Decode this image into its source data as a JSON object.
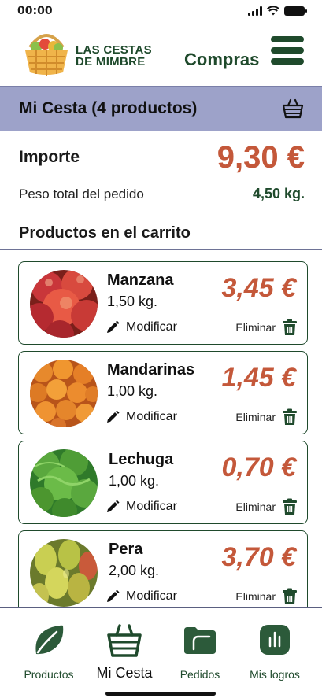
{
  "status_bar": {
    "time": "00:00"
  },
  "header": {
    "logo_line1": "LAS CESTAS",
    "logo_line2": "DE MIMBRE",
    "title": "Compras",
    "menu_icon": "hamburger-icon"
  },
  "section": {
    "title": "Mi Cesta (4 productos)",
    "icon": "basket-icon"
  },
  "summary": {
    "importe_label": "Importe",
    "importe_value": "9,30 €",
    "peso_label": "Peso total del pedido",
    "peso_value": "4,50 kg."
  },
  "cart_heading": "Productos en el carrito",
  "products": [
    {
      "name": "Manzana",
      "weight": "1,50 kg.",
      "price": "3,45 €",
      "modify": "Modificar",
      "remove": "Eliminar",
      "image": "apples"
    },
    {
      "name": "Mandarinas",
      "weight": "1,00 kg.",
      "price": "1,45 €",
      "modify": "Modificar",
      "remove": "Eliminar",
      "image": "tangerines"
    },
    {
      "name": "Lechuga",
      "weight": "1,00 kg.",
      "price": "0,70 €",
      "modify": "Modificar",
      "remove": "Eliminar",
      "image": "lettuce"
    },
    {
      "name": "Pera",
      "weight": "2,00 kg.",
      "price": "3,70 €",
      "modify": "Modificar",
      "remove": "Eliminar",
      "image": "pears"
    }
  ],
  "nav": [
    {
      "label": "Productos",
      "icon": "leaf-icon"
    },
    {
      "label": "Mi Cesta",
      "icon": "basket-icon",
      "active": true
    },
    {
      "label": "Pedidos",
      "icon": "folder-icon"
    },
    {
      "label": "Mis logros",
      "icon": "chart-icon"
    }
  ],
  "colors": {
    "brand_green": "#1f4a2c",
    "price": "#c4583a",
    "section_bg": "#9da2c9"
  }
}
